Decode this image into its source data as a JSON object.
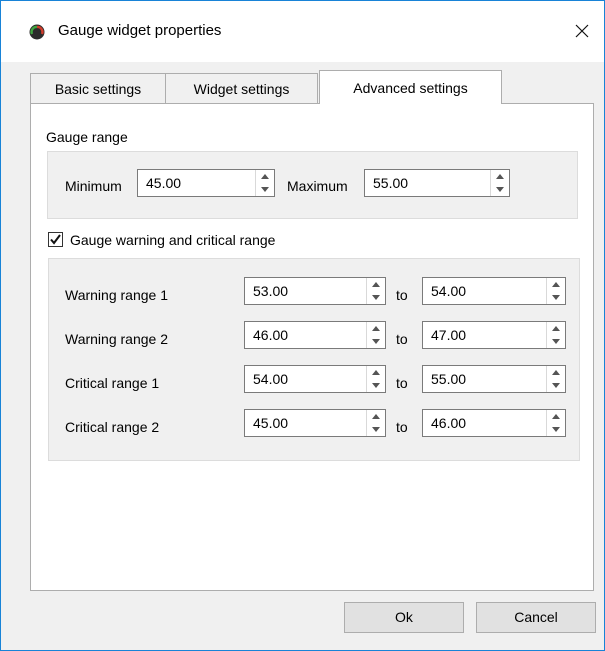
{
  "window": {
    "title": "Gauge widget properties"
  },
  "tabs": [
    "Basic settings",
    "Widget settings",
    "Advanced settings"
  ],
  "gauge_range": {
    "title": "Gauge range",
    "minimum_label": "Minimum",
    "minimum_value": "45.00",
    "maximum_label": "Maximum",
    "maximum_value": "55.00"
  },
  "warning_section": {
    "checkbox_label": "Gauge warning and critical range",
    "checked": true,
    "to_label": "to",
    "rows": [
      {
        "label": "Warning range 1",
        "from": "53.00",
        "to": "54.00"
      },
      {
        "label": "Warning range 2",
        "from": "46.00",
        "to": "47.00"
      },
      {
        "label": "Critical range 1",
        "from": "54.00",
        "to": "55.00"
      },
      {
        "label": "Critical range 2",
        "from": "45.00",
        "to": "46.00"
      }
    ]
  },
  "buttons": {
    "ok": "Ok",
    "cancel": "Cancel"
  },
  "colors": {
    "window_border": "#1883d7",
    "panel_bg": "#f0f0f0"
  }
}
